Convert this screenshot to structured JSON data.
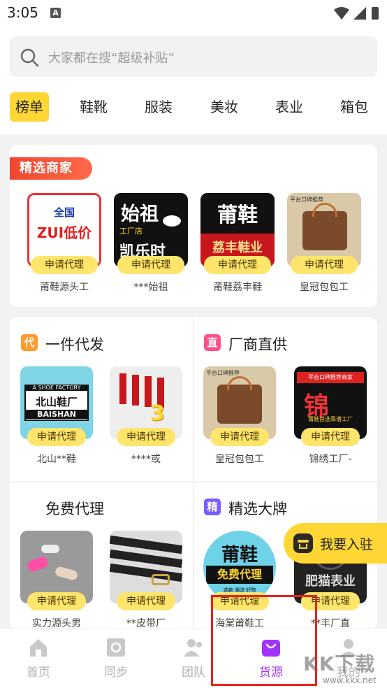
{
  "status": {
    "time": "3:05",
    "notif_badge": "A"
  },
  "search": {
    "placeholder": "大家都在搜“超级补贴”"
  },
  "categories": [
    {
      "label": "榜单",
      "active": true
    },
    {
      "label": "鞋靴"
    },
    {
      "label": "服装"
    },
    {
      "label": "美妆"
    },
    {
      "label": "表业"
    },
    {
      "label": "箱包"
    }
  ],
  "featured": {
    "ribbon": "精选商家",
    "merchants": [
      {
        "name": "莆鞋源头工",
        "action": "申请代理",
        "thumb_line1": "全国",
        "thumb_line2": "ZUI低价"
      },
      {
        "name": "***始祖",
        "action": "申请代理",
        "thumb_line1": "始祖",
        "thumb_line2": "工厂店",
        "thumb_line3": "凯乐时"
      },
      {
        "name": "莆鞋荔丰鞋",
        "action": "申请代理",
        "thumb_line1": "莆鞋",
        "thumb_line2": "荔丰鞋业"
      },
      {
        "name": "皇冠包包工",
        "action": "申请代理",
        "thumb_line1": "平台口碑推荐"
      }
    ]
  },
  "sections": [
    {
      "title": "一件代发",
      "badge": "代",
      "badge_color": "#ff9a2e",
      "items": [
        {
          "name": "北山**鞋",
          "action": "申请代理",
          "thumb_line1": "A SHOE FACTORY",
          "thumb_line2": "北山鞋厂",
          "thumb_line3": "BAISHAN"
        },
        {
          "name": "****或",
          "action": "申请代理",
          "thumb_line1": "3折"
        }
      ]
    },
    {
      "title": "厂商直供",
      "badge": "直",
      "badge_color": "#ff4f8b",
      "items": [
        {
          "name": "皇冠包包工",
          "action": "申请代理",
          "thumb_line1": "平台口碑推荐"
        },
        {
          "name": "锦绣工厂-",
          "action": "申请代理",
          "thumb_line1": "平台口碑推荐商家",
          "thumb_line2": "锦",
          "thumb_line3": "莆鞋首选靠谱工厂"
        }
      ]
    },
    {
      "title": "免费代理",
      "badge": "",
      "badge_color": "",
      "items": [
        {
          "name": "实力源头男",
          "action": "申请代理"
        },
        {
          "name": "**皮带厂",
          "action": "申请代理"
        }
      ]
    },
    {
      "title": "精选大牌",
      "badge": "精",
      "badge_color": "#7a5cff",
      "items": [
        {
          "name": "海棠莆鞋工",
          "action": "申请代理",
          "thumb_line1": "莆鞋",
          "thumb_line2": "免费代理",
          "thumb_line3": "选款·潮流·好物"
        },
        {
          "name": "**丰厂直",
          "action": "申请代理",
          "thumb_line1": "肥猫表业"
        }
      ]
    }
  ],
  "fab": {
    "label": "我要入驻"
  },
  "tabbar": [
    {
      "label": "首页",
      "icon": "home-icon"
    },
    {
      "label": "同步",
      "icon": "sync-icon"
    },
    {
      "label": "团队",
      "icon": "team-icon"
    },
    {
      "label": "货源",
      "icon": "bag-icon",
      "active": true,
      "color": "#a033ff"
    },
    {
      "label": "我的",
      "icon": "profile-icon"
    }
  ],
  "watermark": {
    "brand": "KK下载",
    "url": "www.kkx.net"
  },
  "colors": {
    "accent": "#ffd633",
    "ribbon": "#f0452e",
    "active_tab": "#a033ff",
    "highlight": "#e8221f"
  }
}
